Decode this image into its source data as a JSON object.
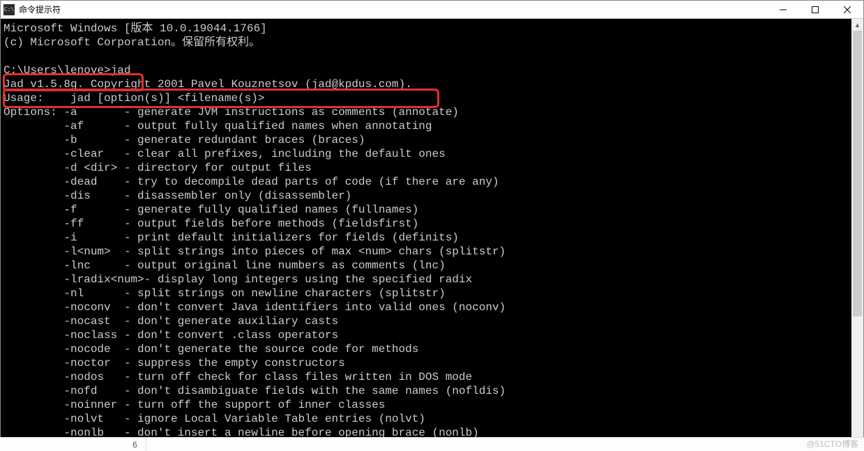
{
  "window": {
    "icon_text": "C:\\",
    "title": "命令提示符"
  },
  "terminal": {
    "line_version": "Microsoft Windows [版本 10.0.19044.1766]",
    "line_copyright": "(c) Microsoft Corporation。保留所有权利。",
    "blank": "",
    "prompt_line": "C:\\Users\\lenove>jad",
    "jad_banner": "Jad v1.5.8g. Copyright 2001 Pavel Kouznetsov (jad@kpdus.com).",
    "usage": "Usage:    jad [option(s)] <filename(s)>",
    "options_header": "Options: ",
    "opts": [
      {
        "flag": "-a",
        "desc": "- generate JVM instructions as comments (annotate)"
      },
      {
        "flag": "-af",
        "desc": "- output fully qualified names when annotating"
      },
      {
        "flag": "-b",
        "desc": "- generate redundant braces (braces)"
      },
      {
        "flag": "-clear",
        "desc": "- clear all prefixes, including the default ones"
      },
      {
        "flag": "-d <dir>",
        "desc": "- directory for output files"
      },
      {
        "flag": "-dead",
        "desc": "- try to decompile dead parts of code (if there are any)"
      },
      {
        "flag": "-dis",
        "desc": "- disassembler only (disassembler)"
      },
      {
        "flag": "-f",
        "desc": "- generate fully qualified names (fullnames)"
      },
      {
        "flag": "-ff",
        "desc": "- output fields before methods (fieldsfirst)"
      },
      {
        "flag": "-i",
        "desc": "- print default initializers for fields (definits)"
      },
      {
        "flag": "-l<num>",
        "desc": "- split strings into pieces of max <num> chars (splitstr)"
      },
      {
        "flag": "-lnc",
        "desc": "- output original line numbers as comments (lnc)"
      },
      {
        "flag": "-lradix<num>",
        "desc": "- display long integers using the specified radix"
      },
      {
        "flag": "-nl",
        "desc": "- split strings on newline characters (splitstr)"
      },
      {
        "flag": "-noconv",
        "desc": "- don't convert Java identifiers into valid ones (noconv)"
      },
      {
        "flag": "-nocast",
        "desc": "- don't generate auxiliary casts"
      },
      {
        "flag": "-noclass",
        "desc": "- don't convert .class operators"
      },
      {
        "flag": "-nocode",
        "desc": "- don't generate the source code for methods"
      },
      {
        "flag": "-noctor",
        "desc": "- suppress the empty constructors"
      },
      {
        "flag": "-nodos",
        "desc": "- turn off check for class files written in DOS mode"
      },
      {
        "flag": "-nofd",
        "desc": "- don't disambiguate fields with the same names (nofldis)"
      },
      {
        "flag": "-noinner",
        "desc": "- turn off the support of inner classes"
      },
      {
        "flag": "-nolvt",
        "desc": "- ignore Local Variable Table entries (nolvt)"
      },
      {
        "flag": "-nonlb",
        "desc": "- don't insert a newline before opening brace (nonlb)"
      }
    ]
  },
  "bottom": {
    "number": "6"
  },
  "watermark": "@51CTO博客"
}
